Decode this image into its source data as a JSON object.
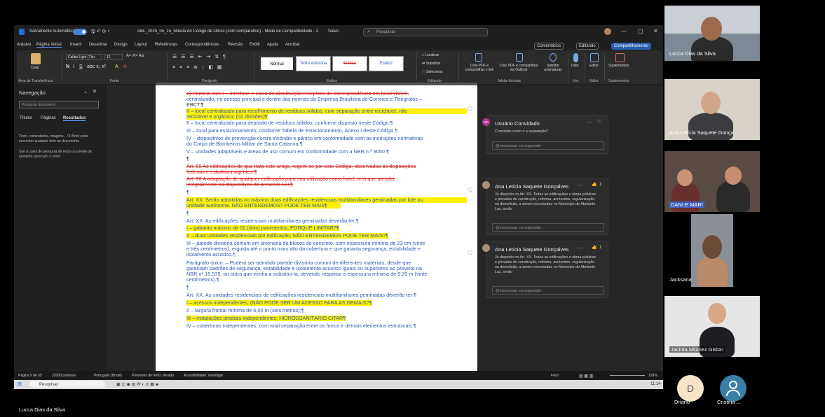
{
  "word": {
    "autosave_label": "Salvamento Automático",
    "doc_title": "ABL_2025_05_15_Minuta do Código de Obras (com comparativo)  -  Modo de Compatibilidade  -  2",
    "saved": "Salvo",
    "search_placeholder": "Pesquisar",
    "menu": [
      "Arquivo",
      "Página Inicial",
      "Inserir",
      "Desenhar",
      "Design",
      "Layout",
      "Referências",
      "Correspondências",
      "Revisão",
      "Exibir",
      "Ajuda",
      "Acrobat"
    ],
    "comments_btn": "Comentários",
    "editing_btn": "Editando",
    "share_btn": "Compartilhamento",
    "ribbon": {
      "paste": "Colar",
      "clipboard": "Área de Transferência",
      "font_name": "Calibri Light (Títu",
      "font_size": "12",
      "font_group": "Fonte",
      "paragraph_group": "Parágrafo",
      "styles": [
        "Normal",
        "Texto Adiciona",
        "Estilo1",
        "Estilo2"
      ],
      "styles_group": "Estilos",
      "find": "Localizar",
      "replace": "Substituir",
      "select": "Selecionar",
      "editing_group": "Editando",
      "pdf1": "Criar PDF e compartilhar o link",
      "pdf2": "Criar PDF e compartilhar via Outlook",
      "sign": "Solicitar assinaturas",
      "acrobat_group": "Adobe Acrobat",
      "dictate": "Ditar",
      "voice_group": "Voz",
      "editor": "Editor",
      "editor_group": "Editor",
      "addins": "Suplementos",
      "addins_group": "Suplementos"
    },
    "nav": {
      "title": "Navegação",
      "search_placeholder": "Pesquisar documento",
      "tabs": [
        "Títulos",
        "Páginas",
        "Resultados"
      ],
      "text1": "Texto, comentários, imagens... O Word pode encontrar qualquer item no documento.",
      "text2": "Use a caixa de pesquisa de texto ou a lente de aumento para tudo o resto."
    },
    "doc_lines": [
      "a) Portaria com  I – interfone e caixa de distribuição receptora de correspondência em local visível,",
      "centralizado, no acesso principal e dentro das normas da Empresa Brasileira de Correios e Telégrafos –",
      "EBCT;¶",
      "II – local centralizado para recolhimento de resíduos sólidos, com separação entre reciclável, não",
      "reciclável e orgânico; (02 divisões)¶",
      "II – local centralizado para depósito de resíduos sólidos, conforme disposto neste Código;¶",
      "III – local para estacionamento, conforme Tabela de Estacionamento, Anexo I deste Código.¶",
      "IV – dispositivos de prevenção contra incêndio e pânico em conformidade com as instruções normativas",
      "do Corpo de Bombeiros Militar de Santa Catarina;¶",
      "V – unidades adaptáveis e áreas de uso comum em conformidade com a NBR n.º 9050.¶",
      "¶",
      "Art. 55 As edificações de que trata este artigo, regem-se por este Código, observadas as disposições",
      "federais e estaduais vigentes.¶",
      "Art. 56 A adaptação de qualquer edificação para sua utilização como hotel, terá que atender",
      "integralmente os dispositivos do presente Lei.¶",
      "¶",
      "Art. XX. Serão admitidas no máximo duas edificações residenciais multifamiliares geminadas por lote ou",
      "unidade autônoma. NÃO ENTENDEMOS? PODE TER MAIS¶",
      "¶",
      "Art. XX. As edificações residenciais multifamiliares geminadas deverão ter:¶",
      "I – gabarito máximo de 02 (dois) pavimentos; PORQUE LIMITAR?¶",
      "II – duas unidades residenciais por edificação; NÃO ENTENDEMOS PODE TER MAIS?¶",
      "III – parede divisória comum em alvenaria de blocos de concreto, com espessura mínima de 23 cm (vinte",
      "e três centímetros), erguida até o ponto mais alto da cobertura e que garanta segurança, estabilidade e",
      "isolamento acústico.¶",
      "Parágrafo único. – Poderá ser admitida parede divisória comum de diferentes materiais, desde que",
      "garantam padrões de segurança, estabilidade e isolamento acústico iguais ou superiores ao previsto na",
      "NBR nº 15.575, ou outra que venha a substituí-la, devendo respeitar a espessura mínima de 0,20 m (vinte",
      "centímetros).¶",
      "¶",
      "Art. XX. As unidades residenciais de edificações residenciais multifamiliares geminadas deverão ter:¶",
      "I – acessos independentes; (NÃO PODE SER UM ACESSO PARA AS DEMAIS?¶",
      "II – largura frontal mínima de 6,00 m (seis metros);¶",
      "III – instalações prediais independentes; HIDROSSANITÁRIO CITAR¶",
      "IV – coberturas independentes, com total separação entre os forros e demais elementos estruturais.¶"
    ],
    "comments": [
      {
        "author": "Usuário Convidado",
        "initials": "UC",
        "body": "Comissão como é a separação?",
        "reply": "@mencionar ou responder"
      },
      {
        "author": "Ana Letícia Saquete Gonçalves",
        "likes": "1",
        "body": "Já disposto no Art. XX.  Todas as edificações e obras públicas e privadas de construção, reforma, acréscimo, regularização ou demolição, a serem executadas no Município de Abelardo Luz, serão",
        "reply": "@mencionar ou responder"
      },
      {
        "author": "Ana Letícia Saquete Gonçalves",
        "likes": "1",
        "body": "Já disposto no Art. XX.  Todas as edificações e obras públicas e privadas de construção, reforma, acréscimo, regularização ou demolição, a serem executadas no Município de Abelardo Luz, serão",
        "reply": "@mencionar ou responder"
      }
    ],
    "status": {
      "page": "Página 9 de 55",
      "words": "22000 palavras",
      "lang": "Português (Brasil)",
      "predict": "Previsões de texto: ativado",
      "access": "Acessibilidade: investigar",
      "focus": "Foco",
      "zoom": "120%"
    }
  },
  "taskbar": {
    "search": "Pesquisar",
    "time": "11:14"
  },
  "participants": [
    {
      "name": "Lucca Dias da Silva"
    },
    {
      "name": "Ana Letícia Saquete Gonça..."
    },
    {
      "name": "DANI E MARI"
    },
    {
      "name": "Jacksana"
    },
    {
      "name": "Jacinta Milanez Gislon"
    }
  ],
  "avatars": [
    {
      "initial": "D",
      "name": "Driano"
    },
    {
      "name": "Cristina ..."
    }
  ],
  "presenter": "Lucca Dias da Silva"
}
